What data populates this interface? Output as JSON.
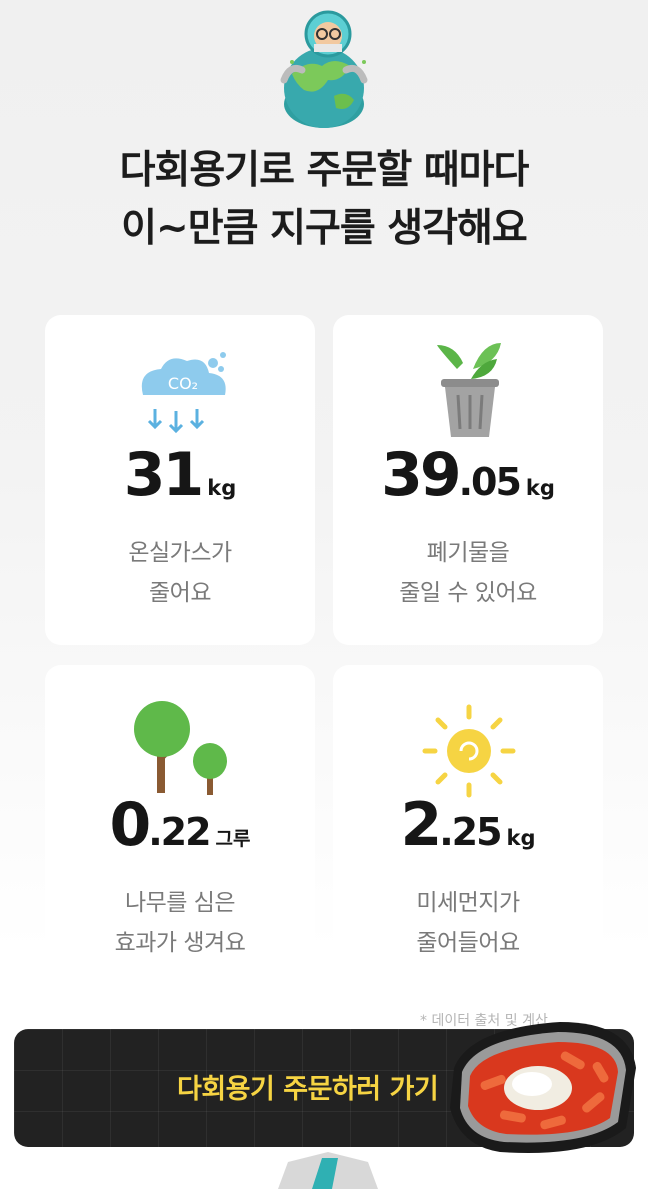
{
  "header": {
    "title_line1": "다회용기로 주문할 때마다",
    "title_line2": "이~만큼 지구를 생각해요"
  },
  "cards": [
    {
      "icon": "co2-cloud-icon",
      "value_big": "31",
      "value_small": "",
      "unit": "kg",
      "desc_line1": "온실가스가",
      "desc_line2": "줄어요"
    },
    {
      "icon": "trash-can-leaf-icon",
      "value_big": "39",
      "value_small": ".05",
      "unit": "kg",
      "desc_line1": "폐기물을",
      "desc_line2": "줄일 수 있어요"
    },
    {
      "icon": "trees-icon",
      "value_big": "0",
      "value_small": ".22",
      "unit": "그루",
      "desc_line1": "나무를 심은",
      "desc_line2": "효과가 생겨요"
    },
    {
      "icon": "sun-icon",
      "value_big": "2",
      "value_small": ".25",
      "unit": "kg",
      "desc_line1": "미세먼지가",
      "desc_line2": "줄어들어요"
    }
  ],
  "source_note": "* 데이터 출처 및 계산",
  "cta": {
    "label": "다회용기 주문하러 가기"
  },
  "colors": {
    "accent_yellow": "#f6d443",
    "cta_background": "#222222",
    "card_background": "#ffffff"
  }
}
